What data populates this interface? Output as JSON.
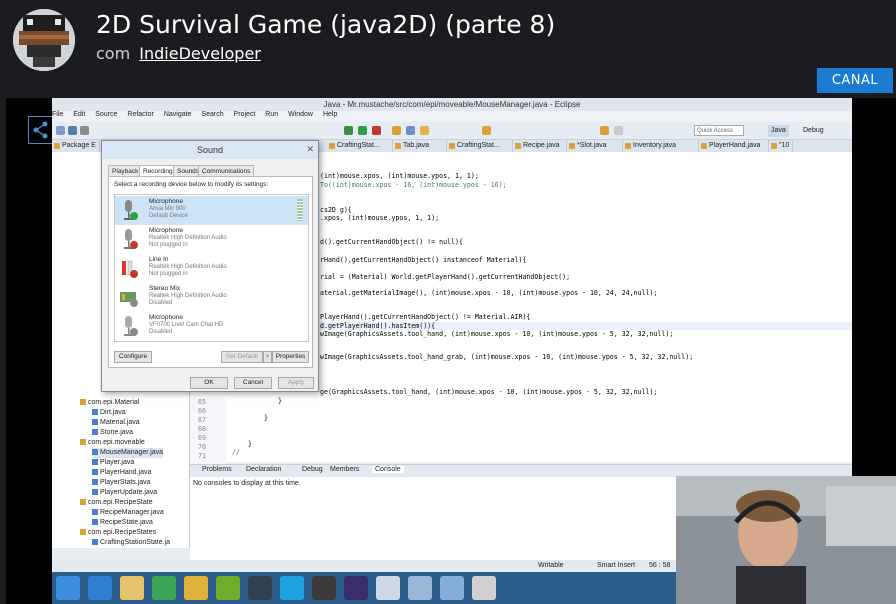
{
  "header": {
    "title": "2D Survival Game (java2D) (parte 8)",
    "by_prefix": "com",
    "channel_name": "IndieDeveloper",
    "channel_button": "CANAL"
  },
  "eclipse": {
    "window_title": "Java - Mr.mustache/src/com/epi/moveable/MouseManager.java - Eclipse",
    "menu": [
      "File",
      "Edit",
      "Source",
      "Refactor",
      "Navigate",
      "Search",
      "Project",
      "Run",
      "Window",
      "Help"
    ],
    "quick_access": "Quick Access",
    "perspective_java": "Java",
    "perspective_debug": "Debug",
    "package_explorer_label": "Package E",
    "tabs": [
      "CraftingStat...",
      "Tab.java",
      "CraftingStat...",
      "Recipe.java",
      "*Slot.java",
      "Inventory.java",
      "PlayerHand.java",
      "\"10"
    ],
    "package_tree": [
      {
        "label": "com.epi.Material",
        "kind": "package"
      },
      {
        "label": "Dirt.java",
        "kind": "file"
      },
      {
        "label": "Material.java",
        "kind": "file"
      },
      {
        "label": "Stone.java",
        "kind": "file"
      },
      {
        "label": "com.epi.moveable",
        "kind": "package"
      },
      {
        "label": "MouseManager.java",
        "kind": "file"
      },
      {
        "label": "Player.java",
        "kind": "file"
      },
      {
        "label": "PlayerHand.java",
        "kind": "file"
      },
      {
        "label": "PlayerStats.java",
        "kind": "file"
      },
      {
        "label": "PlayerUpdate.java",
        "kind": "file"
      },
      {
        "label": "com.epi.RecipeState",
        "kind": "package"
      },
      {
        "label": "RecipeManager.java",
        "kind": "file"
      },
      {
        "label": "RecipeState.java",
        "kind": "file"
      },
      {
        "label": "com.epi.RecipeStates",
        "kind": "package"
      },
      {
        "label": "CraftingStationState.ja",
        "kind": "file"
      }
    ],
    "line_numbers": [
      "65",
      "66",
      "67",
      "68",
      "69",
      "70",
      "71"
    ],
    "console_tabs": [
      "Problems",
      "Declaration",
      "Debug",
      "Members",
      "Console"
    ],
    "console_message": "No consoles to display at this time.",
    "status": {
      "mode": "Writable",
      "insert": "Smart Insert",
      "position": "56 : 58"
    }
  },
  "sound_dialog": {
    "title": "Sound",
    "tabs": [
      "Playback",
      "Recording",
      "Sounds",
      "Communications"
    ],
    "active_tab": "Recording",
    "instruction": "Select a recording device below to modify its settings:",
    "devices": [
      {
        "name": "Microphone",
        "driver": "Anua Mic 900",
        "state": "Default Device",
        "icon": "microphone-default-icon"
      },
      {
        "name": "Microphone",
        "driver": "Realtek High Definition Audio",
        "state": "Not plugged in",
        "icon": "microphone-icon"
      },
      {
        "name": "Line In",
        "driver": "Realtek High Definition Audio",
        "state": "Not plugged in",
        "icon": "line-in-icon"
      },
      {
        "name": "Stereo Mix",
        "driver": "Realtek High Definition Audio",
        "state": "Disabled",
        "icon": "stereo-mix-icon"
      },
      {
        "name": "Microphone",
        "driver": "VF0700 Live! Cam Chat HD",
        "state": "Disabled",
        "icon": "webcam-mic-icon"
      }
    ],
    "buttons": {
      "configure": "Configure",
      "set_default": "Set Default",
      "properties": "Properties",
      "ok": "OK",
      "cancel": "Cancel",
      "apply": "Apply"
    }
  },
  "code_lines": [
    {
      "text": "(int)mouse.xpos, (int)mouse.ypos, 1, 1);"
    },
    {
      "text": "To((int)mouse.xpos - 16, (int)mouse.ypos - 16);"
    },
    {
      "text": "cs2D g){"
    },
    {
      "text": ".xpos, (int)mouse.ypos, 1, 1);"
    },
    {
      "text": "d().getCurrentHandObject() != null){"
    },
    {
      "text": "rHand().getCurrentHandObject() instanceof Material){"
    },
    {
      "text": "rial = (Material) World.getPlayerHand().getCurrentHandObject();"
    },
    {
      "text": "aterial.getMaterialImage(), (int)mouse.xpos - 10, (int)mouse.ypos - 10, 24, 24,null);"
    },
    {
      "text": "PlayerHand().getCurrentHandObject() != Material.AIR){"
    },
    {
      "text": "d.getPlayerHand().hasItem()){"
    },
    {
      "text": "wImage(GraphicsAssets.tool_hand, (int)mouse.xpos - 10, (int)mouse.ypos - 5, 32, 32,null);"
    },
    {
      "text": "wImage(GraphicsAssets.tool_hand_grab, (int)mouse.xpos - 10, (int)mouse.ypos - 5, 32, 32,null);"
    },
    {
      "text": "ge(GraphicsAssets.tool_hand, (int)mouse.xpos - 10, (int)mouse.ypos - 5, 32, 32,null);"
    },
    {
      "text": "}"
    },
    {
      "text": "}"
    },
    {
      "text": "}"
    },
    {
      "text": "//"
    }
  ],
  "colors": {
    "accent": "#1a7bd3",
    "header_bg": "#1b1c1f",
    "taskbar": "#2d5d8a"
  }
}
